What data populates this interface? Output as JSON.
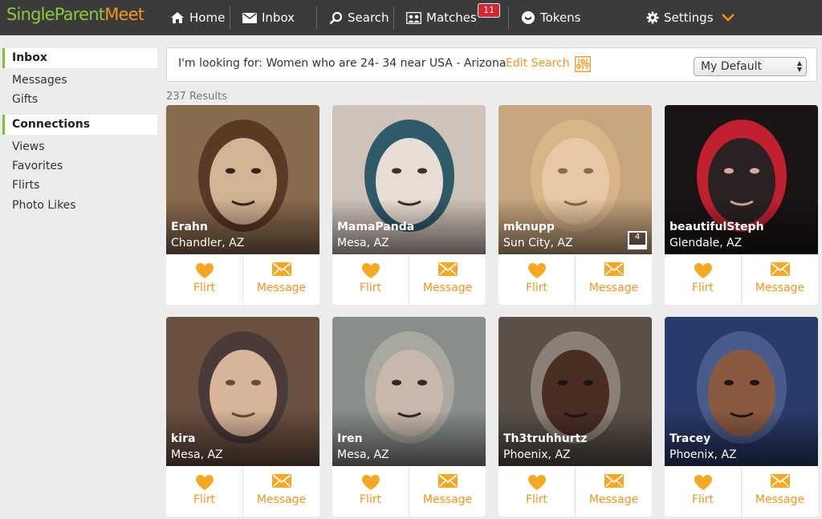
{
  "logo": {
    "part1": "SingleParent",
    "part2": "Meet"
  },
  "nav": {
    "home": "Home",
    "inbox": "Inbox",
    "search": "Search",
    "matches": "Matches",
    "matches_badge": "11",
    "tokens": "Tokens",
    "settings": "Settings"
  },
  "sidebar": {
    "inbox_header": "Inbox",
    "inbox_items": [
      "Messages",
      "Gifts"
    ],
    "connections_header": "Connections",
    "connections_items": [
      "Views",
      "Favorites",
      "Flirts",
      "Photo Likes"
    ]
  },
  "search": {
    "criteria": "I'm looking for: Women who are 24- 34 near USA - Arizona",
    "edit_label": "Edit Search",
    "sort_selected": "My Default"
  },
  "results_label": "237 Results",
  "actions": {
    "flirt": "Flirt",
    "message": "Message"
  },
  "profiles": [
    {
      "name": "Erahn",
      "location": "Chandler, AZ",
      "photo_count": ""
    },
    {
      "name": "MamaPanda",
      "location": "Mesa, AZ",
      "photo_count": ""
    },
    {
      "name": "mknupp",
      "location": "Sun City, AZ",
      "photo_count": "4"
    },
    {
      "name": "beautifulSteph",
      "location": "Glendale, AZ",
      "photo_count": ""
    },
    {
      "name": "kira",
      "location": "Mesa, AZ",
      "photo_count": ""
    },
    {
      "name": "Iren",
      "location": "Mesa, AZ",
      "photo_count": ""
    },
    {
      "name": "Th3truhhurtz",
      "location": "Phoenix, AZ",
      "photo_count": ""
    },
    {
      "name": "Tracey",
      "location": "Phoenix, AZ",
      "photo_count": ""
    }
  ],
  "colors": {
    "accent": "#f7941d",
    "brand_green": "#8dc63f",
    "topbar": "#3b3b3b",
    "badge": "#d9232d"
  }
}
